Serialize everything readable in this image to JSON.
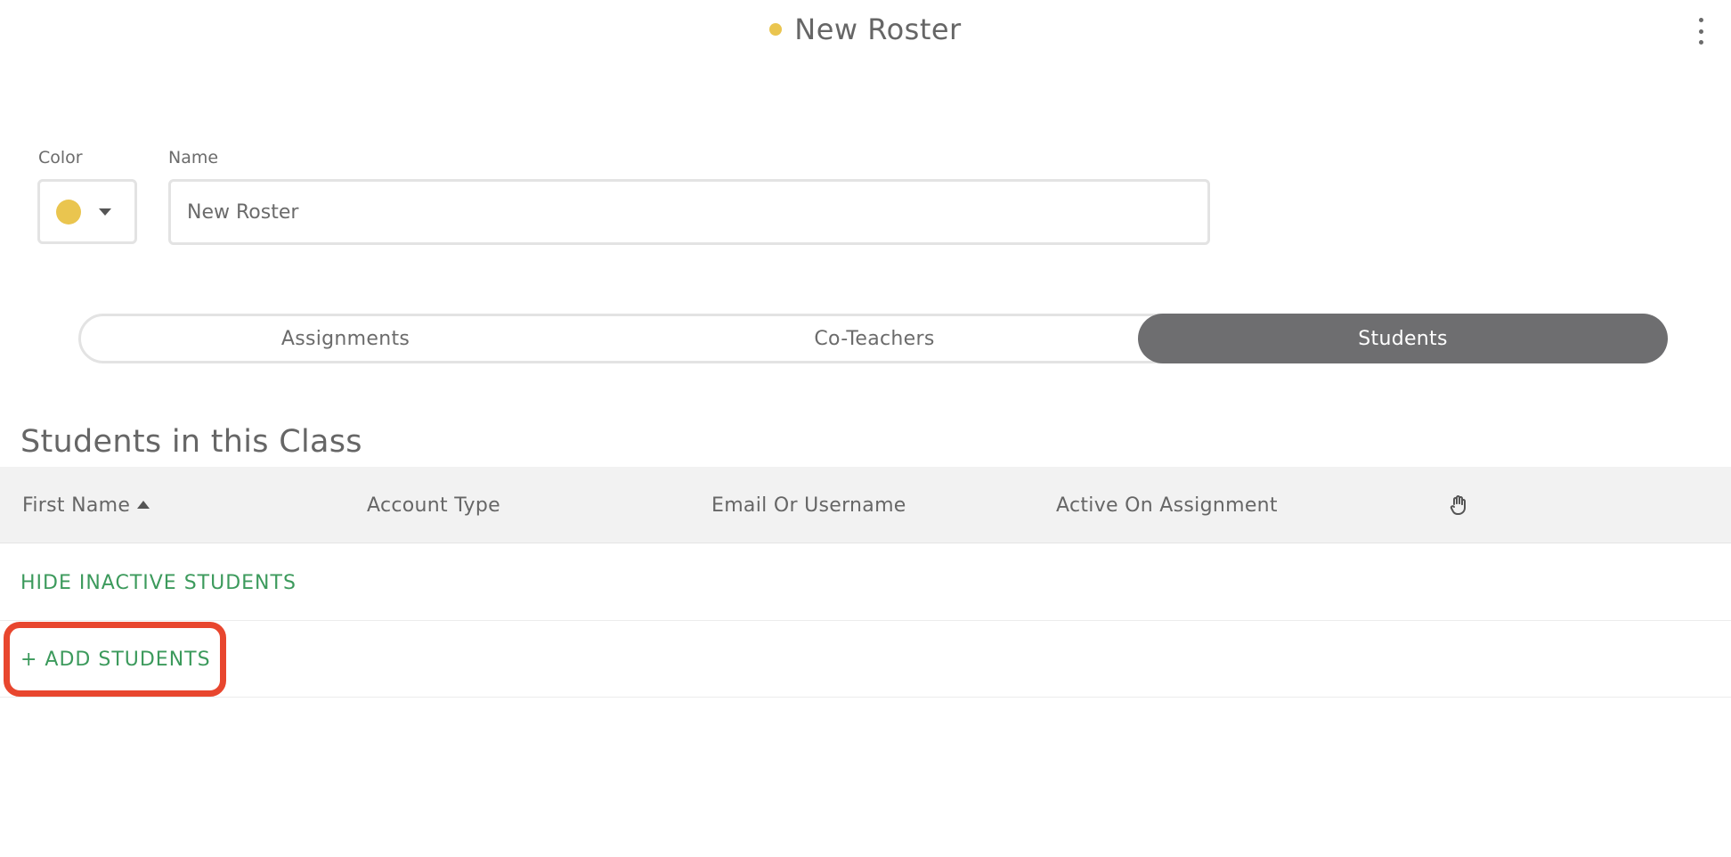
{
  "header": {
    "title": "New Roster",
    "title_dot_color": "#eac54f",
    "menu_icon": "more-vertical-icon"
  },
  "form": {
    "color_label": "Color",
    "color_value": "#eac54f",
    "name_label": "Name",
    "name_value": "New Roster"
  },
  "tabs": [
    {
      "label": "Assignments",
      "active": false
    },
    {
      "label": "Co-Teachers",
      "active": false
    },
    {
      "label": "Students",
      "active": true
    }
  ],
  "section": {
    "title": "Students in this Class"
  },
  "table": {
    "columns": [
      {
        "label": "First Name",
        "sorted": "asc"
      },
      {
        "label": "Account Type"
      },
      {
        "label": "Email Or Username"
      },
      {
        "label": "Active On Assignment"
      },
      {
        "label": "",
        "icon": "hand-icon"
      }
    ]
  },
  "actions": {
    "hide_inactive": "HIDE INACTIVE STUDENTS",
    "add_students": "+ ADD STUDENTS"
  },
  "colors": {
    "accent_green": "#3c9a5c",
    "active_tab": "#6e6e70",
    "highlight": "#e8462e"
  }
}
